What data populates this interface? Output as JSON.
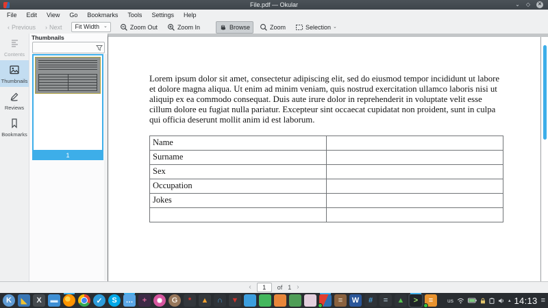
{
  "window": {
    "title": "File.pdf — Okular"
  },
  "menu": {
    "items": [
      "File",
      "Edit",
      "View",
      "Go",
      "Bookmarks",
      "Tools",
      "Settings",
      "Help"
    ]
  },
  "toolbar": {
    "previous": "Previous",
    "next": "Next",
    "fit_mode": "Fit Width",
    "zoom_out": "Zoom Out",
    "zoom_in": "Zoom In",
    "browse": "Browse",
    "zoom": "Zoom",
    "selection": "Selection"
  },
  "sidebar": {
    "tabs": [
      {
        "label": "Contents",
        "state": "disabled"
      },
      {
        "label": "Thumbnails",
        "state": "selected"
      },
      {
        "label": "Reviews",
        "state": "normal"
      },
      {
        "label": "Bookmarks",
        "state": "normal"
      }
    ]
  },
  "thumbnails_panel": {
    "title": "Thumbnails",
    "filter_value": "",
    "page_label": "1"
  },
  "document": {
    "paragraph": "Lorem ipsum dolor sit amet, consectetur adipiscing elit, sed do eiusmod tempor incididunt ut labore et dolore magna aliqua. Ut enim ad minim veniam, quis nostrud exercitation ullamco laboris nisi ut aliquip ex ea commodo consequat. Duis aute irure dolor in reprehenderit in voluptate velit esse cillum dolore eu fugiat nulla pariatur. Excepteur sint occaecat cupidatat non proident, sunt in culpa qui officia deserunt mollit anim id est laborum.",
    "table_rows": [
      "Name",
      "Surname",
      "Sex",
      "Occupation",
      "Jokes",
      ""
    ]
  },
  "page_nav": {
    "current": "1",
    "of_label": "of",
    "total": "1"
  },
  "taskbar": {
    "apps": [
      {
        "name": "app-launcher",
        "shape": "circle",
        "bg": "#5f9bd4",
        "glyph": "K",
        "fg": "#ffffff"
      },
      {
        "name": "desktop-pager",
        "shape": "square",
        "bg": "#3876b5",
        "glyph": "◣",
        "fg": "#f2c330"
      },
      {
        "name": "xterm",
        "shape": "square",
        "bg": "#44494e",
        "glyph": "X",
        "fg": "#eceff1"
      },
      {
        "name": "dolphin-files",
        "shape": "square",
        "bg": "#3e8fd4",
        "glyph": "▬",
        "fg": "#d8ecff"
      },
      {
        "name": "firefox",
        "shape": "circle",
        "special": "fx",
        "running": true
      },
      {
        "name": "chrome",
        "shape": "circle",
        "special": "chrome"
      },
      {
        "name": "check-app",
        "shape": "circle",
        "bg": "#2d9cdb",
        "glyph": "✓",
        "fg": "#ffffff"
      },
      {
        "name": "skype",
        "shape": "circle",
        "bg": "#00a8e8",
        "glyph": "S",
        "fg": "#ffffff"
      },
      {
        "name": "messenger",
        "shape": "square",
        "bg": "#5aa7e6",
        "glyph": "…",
        "fg": "#ffffff",
        "running": true
      },
      {
        "name": "plasma-tool",
        "shape": "square",
        "bg": "#3d2b47",
        "glyph": "+",
        "fg": "#e06c9f"
      },
      {
        "name": "donut-app",
        "shape": "circle",
        "special": "donut"
      },
      {
        "name": "gimp",
        "shape": "circle",
        "bg": "#97775b",
        "glyph": "G",
        "fg": "#f4ece2"
      },
      {
        "name": "krita",
        "shape": "square",
        "bg": "#33373c",
        "glyph": "*",
        "fg": "#e0362c"
      },
      {
        "name": "vlc",
        "shape": "square",
        "bg": "#35393d",
        "glyph": "▲",
        "fg": "#f0a030"
      },
      {
        "name": "audio-headphones",
        "shape": "square",
        "bg": "#2f3338",
        "glyph": "∩",
        "fg": "#4aa3df"
      },
      {
        "name": "kdenlive",
        "shape": "square",
        "bg": "#35393d",
        "glyph": "▼",
        "fg": "#d0342c"
      },
      {
        "name": "doc-blue",
        "shape": "square",
        "bg": "#3c9ede",
        "glyph": "",
        "fg": "#ffffff"
      },
      {
        "name": "doc-green",
        "shape": "square",
        "bg": "#43b75d",
        "glyph": "",
        "fg": "#ffffff"
      },
      {
        "name": "doc-orange",
        "shape": "square",
        "bg": "#e8863a",
        "glyph": "",
        "fg": "#ffffff"
      },
      {
        "name": "doc-image",
        "shape": "square",
        "bg": "#4f9e57",
        "glyph": "",
        "fg": "#ffffff"
      },
      {
        "name": "doc-pink",
        "shape": "square",
        "bg": "#e3cfdd",
        "glyph": "",
        "fg": "#9b5b86"
      },
      {
        "name": "okular",
        "shape": "square",
        "special": "okular",
        "running": true,
        "dot": true
      },
      {
        "name": "books",
        "shape": "square",
        "bg": "#8a623f",
        "glyph": "≡",
        "fg": "#e8d9c4"
      },
      {
        "name": "word",
        "shape": "square",
        "bg": "#2b579a",
        "glyph": "W",
        "fg": "#ffffff"
      },
      {
        "name": "tune-monitor",
        "shape": "square",
        "bg": "#2f3338",
        "glyph": "#",
        "fg": "#4aa3df"
      },
      {
        "name": "sliders",
        "shape": "square",
        "bg": "#32363a",
        "glyph": "=",
        "fg": "#9fb3c0"
      },
      {
        "name": "system-monitor",
        "shape": "square",
        "bg": "#2f3338",
        "glyph": "▲",
        "fg": "#57c44f"
      },
      {
        "name": "konsole",
        "shape": "square",
        "bg": "#1f2428",
        "glyph": ">",
        "fg": "#9fe06c",
        "running": true,
        "active": true
      },
      {
        "name": "notes-orange",
        "shape": "square",
        "bg": "#e8932f",
        "glyph": "≡",
        "fg": "#ffffff",
        "dot": true
      }
    ],
    "tray": {
      "keyboard_layout": "us",
      "clock": "14:13",
      "overflow": "≡"
    }
  },
  "colors": {
    "accent": "#3daee9",
    "titlebar": "#454c52",
    "taskbar": "#292d31",
    "toolbar_bg": "#eff0f1",
    "selected_tab_bg": "#c3ddf1"
  }
}
